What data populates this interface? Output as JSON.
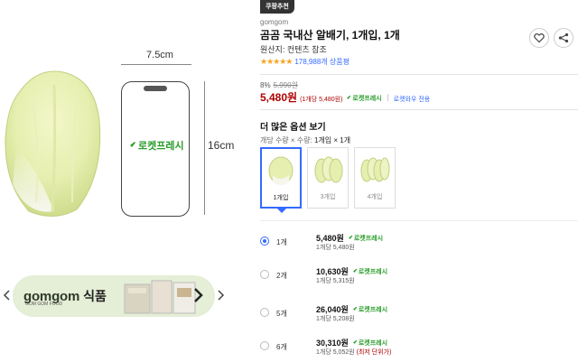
{
  "left_panel": {
    "phone_width_label": "7.5cm",
    "phone_height_label": "16cm",
    "phone_badge": "로켓프레시",
    "brand_banner": {
      "logo_text": "gomgom",
      "logo_sub": "GOM GOM FOOD",
      "name": "식품"
    }
  },
  "product": {
    "badge": "쿠팡추천",
    "seller": "gomgom",
    "title": "곰곰 국내산 알배기, 1개입, 1개",
    "origin": "원산지: 컨텐츠 참조",
    "rating_count": "178,988개 상품평",
    "discount_rate": "8%",
    "original_price": "5,990원",
    "price": "5,480원",
    "unit_price": "(1개당 5,480원)",
    "rocket_label": "로켓프레시",
    "wow_label": "로켓와우 전용"
  },
  "options": {
    "heading": "더 많은 옵션 보기",
    "hint_prefix": "개당 수량 × 수량:",
    "hint_value": "1개입 × 1개",
    "thumbs": [
      {
        "label": "1개입",
        "selected": true
      },
      {
        "label": "3개입",
        "selected": false
      },
      {
        "label": "4개입",
        "selected": false
      }
    ],
    "rows": [
      {
        "qty": "1개",
        "price": "5,480원",
        "unit": "1개당 5,480원",
        "lowest": "",
        "selected": true
      },
      {
        "qty": "2개",
        "price": "10,630원",
        "unit": "1개당 5,315원",
        "lowest": "",
        "selected": false
      },
      {
        "qty": "5개",
        "price": "26,040원",
        "unit": "1개당 5,208원",
        "lowest": "",
        "selected": false
      },
      {
        "qty": "6개",
        "price": "30,310원",
        "unit": "1개당 5,052원",
        "lowest": "(최저 단위가)",
        "selected": false
      }
    ],
    "rocket_label": "로켓프레시"
  },
  "colors": {
    "accent": "#346aff",
    "price_red": "#ae0000",
    "rocket_green": "#2a9d2a"
  }
}
